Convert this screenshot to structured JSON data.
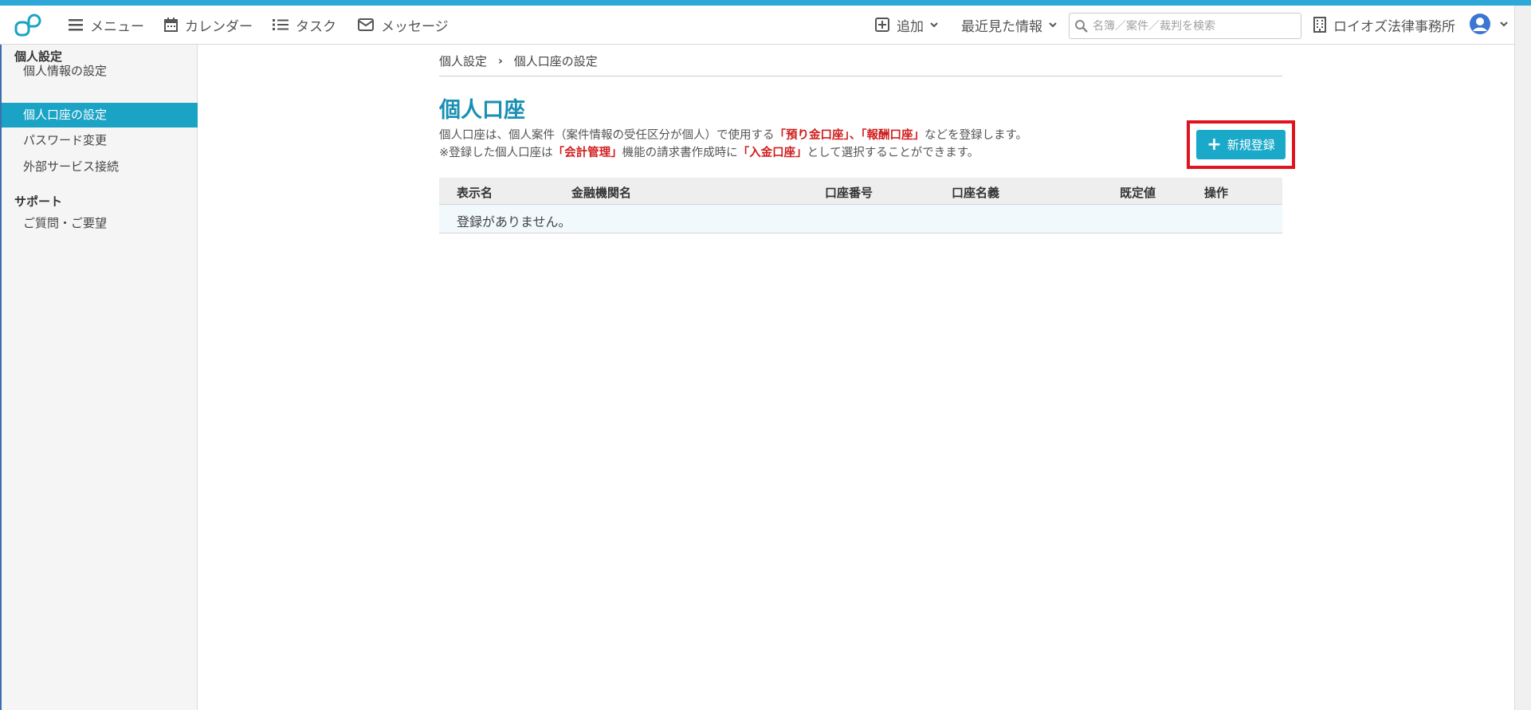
{
  "topnav": {
    "menu": "メニュー",
    "calendar": "カレンダー",
    "tasks": "タスク",
    "messages": "メッセージ",
    "add": "追加",
    "recent": "最近見た情報",
    "search_placeholder": "名簿／案件／裁判を検索",
    "office": "ロイオズ法律事務所"
  },
  "sidebar": {
    "section1": "個人設定",
    "items1": [
      "個人情報の設定",
      "個人口座の設定",
      "パスワード変更",
      "外部サービス接続"
    ],
    "section2": "サポート",
    "items2": [
      "ご質問・ご要望"
    ],
    "active_item": "個人口座の設定"
  },
  "breadcrumb": [
    "個人設定",
    "個人口座の設定"
  ],
  "page": {
    "title": "個人口座",
    "desc1_a": "個人口座は、個人案件（案件情報の受任区分が個人）で使用する",
    "desc1_hl": "「預り金口座」、「報酬口座」",
    "desc1_b": "などを登録します。",
    "desc2_a": "※登録した個人口座は",
    "desc2_hl1": "「会計管理」",
    "desc2_b": "機能の請求書作成時に",
    "desc2_hl2": "「入金口座」",
    "desc2_c": "として選択することができます。",
    "new_button": "新規登録"
  },
  "table": {
    "columns": [
      "表示名",
      "金融機関名",
      "口座番号",
      "口座名義",
      "既定値",
      "操作"
    ],
    "empty_text": "登録がありません。"
  },
  "colors": {
    "accent": "#1aa3c5",
    "title": "#1a8fb4",
    "highlight": "#d11d1d",
    "annotation_box": "#e0141e"
  }
}
